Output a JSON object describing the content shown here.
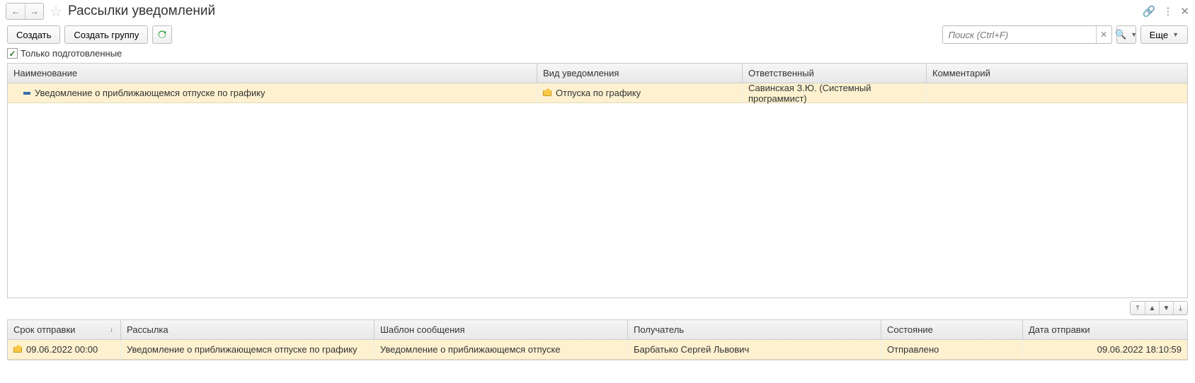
{
  "titlebar": {
    "title": "Рассылки уведомлений"
  },
  "toolbar": {
    "create": "Создать",
    "create_group": "Создать группу",
    "more": "Еще",
    "search_placeholder": "Поиск (Ctrl+F)"
  },
  "filter": {
    "only_prepared": "Только подготовленные"
  },
  "top_grid": {
    "headers": {
      "name": "Наименование",
      "type": "Вид уведомления",
      "responsible": "Ответственный",
      "comment": "Комментарий"
    },
    "rows": [
      {
        "name": "Уведомление о приближающемся отпуске по графику",
        "type": "Отпуска по графику",
        "responsible": "Савинская З.Ю. (Системный программист)",
        "comment": ""
      }
    ]
  },
  "bottom_grid": {
    "headers": {
      "send_date": "Срок отправки",
      "mailing": "Рассылка",
      "template": "Шаблон сообщения",
      "recipient": "Получатель",
      "state": "Состояние",
      "date_sent": "Дата отправки"
    },
    "rows": [
      {
        "send_date": "09.06.2022 00:00",
        "mailing": "Уведомление о приближающемся отпуске по графику",
        "template": "Уведомление о приближающемся отпуске",
        "recipient": "Барбатько Сергей Львович",
        "state": "Отправлено",
        "date_sent": "09.06.2022 18:10:59"
      }
    ]
  }
}
